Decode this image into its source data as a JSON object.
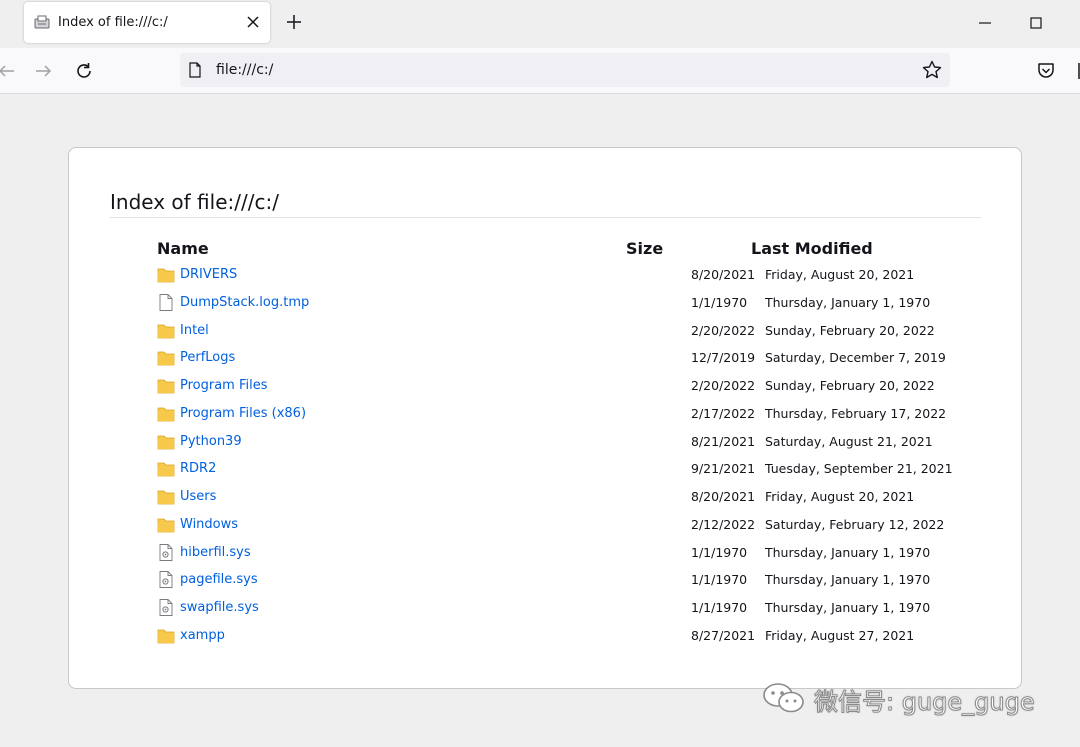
{
  "browser": {
    "tab": {
      "title": "Index of file:///c:/"
    },
    "url": "file:///c:/"
  },
  "listing": {
    "heading": "Index of file:///c:/",
    "columns": {
      "name": "Name",
      "size": "Size",
      "modified": "Last Modified"
    },
    "rows": [
      {
        "type": "folder",
        "name": "DRIVERS",
        "date": "8/20/2021",
        "full": "Friday, August 20, 2021"
      },
      {
        "type": "file",
        "name": "DumpStack.log.tmp",
        "date": "1/1/1970",
        "full": "Thursday, January 1, 1970"
      },
      {
        "type": "folder",
        "name": "Intel",
        "date": "2/20/2022",
        "full": "Sunday, February 20, 2022"
      },
      {
        "type": "folder",
        "name": "PerfLogs",
        "date": "12/7/2019",
        "full": "Saturday, December 7, 2019"
      },
      {
        "type": "folder",
        "name": "Program Files",
        "date": "2/20/2022",
        "full": "Sunday, February 20, 2022"
      },
      {
        "type": "folder",
        "name": "Program Files (x86)",
        "date": "2/17/2022",
        "full": "Thursday, February 17, 2022"
      },
      {
        "type": "folder",
        "name": "Python39",
        "date": "8/21/2021",
        "full": "Saturday, August 21, 2021"
      },
      {
        "type": "folder",
        "name": "RDR2",
        "date": "9/21/2021",
        "full": "Tuesday, September 21, 2021"
      },
      {
        "type": "folder",
        "name": "Users",
        "date": "8/20/2021",
        "full": "Friday, August 20, 2021"
      },
      {
        "type": "folder",
        "name": "Windows",
        "date": "2/12/2022",
        "full": "Saturday, February 12, 2022"
      },
      {
        "type": "sysfile",
        "name": "hiberfil.sys",
        "date": "1/1/1970",
        "full": "Thursday, January 1, 1970"
      },
      {
        "type": "sysfile",
        "name": "pagefile.sys",
        "date": "1/1/1970",
        "full": "Thursday, January 1, 1970"
      },
      {
        "type": "sysfile",
        "name": "swapfile.sys",
        "date": "1/1/1970",
        "full": "Thursday, January 1, 1970"
      },
      {
        "type": "folder",
        "name": "xampp",
        "date": "8/27/2021",
        "full": "Friday, August 27, 2021"
      }
    ]
  },
  "watermark": {
    "text": "微信号: guge_guge"
  },
  "icons": {
    "tab_favicon": "printer-page-icon",
    "tab_close": "close-icon",
    "new_tab": "plus-icon",
    "minimize": "minimize-icon",
    "maximize": "maximize-icon",
    "back": "arrow-left-icon",
    "forward": "arrow-right-icon",
    "reload": "reload-icon",
    "url_page": "page-icon",
    "bookmark": "star-icon",
    "pocket": "pocket-icon",
    "folder": "folder-icon",
    "file": "file-icon",
    "sysfile": "system-file-icon"
  },
  "colors": {
    "link": "#0060df",
    "folder": "#f6c94a",
    "page_bg": "#efeff0"
  }
}
